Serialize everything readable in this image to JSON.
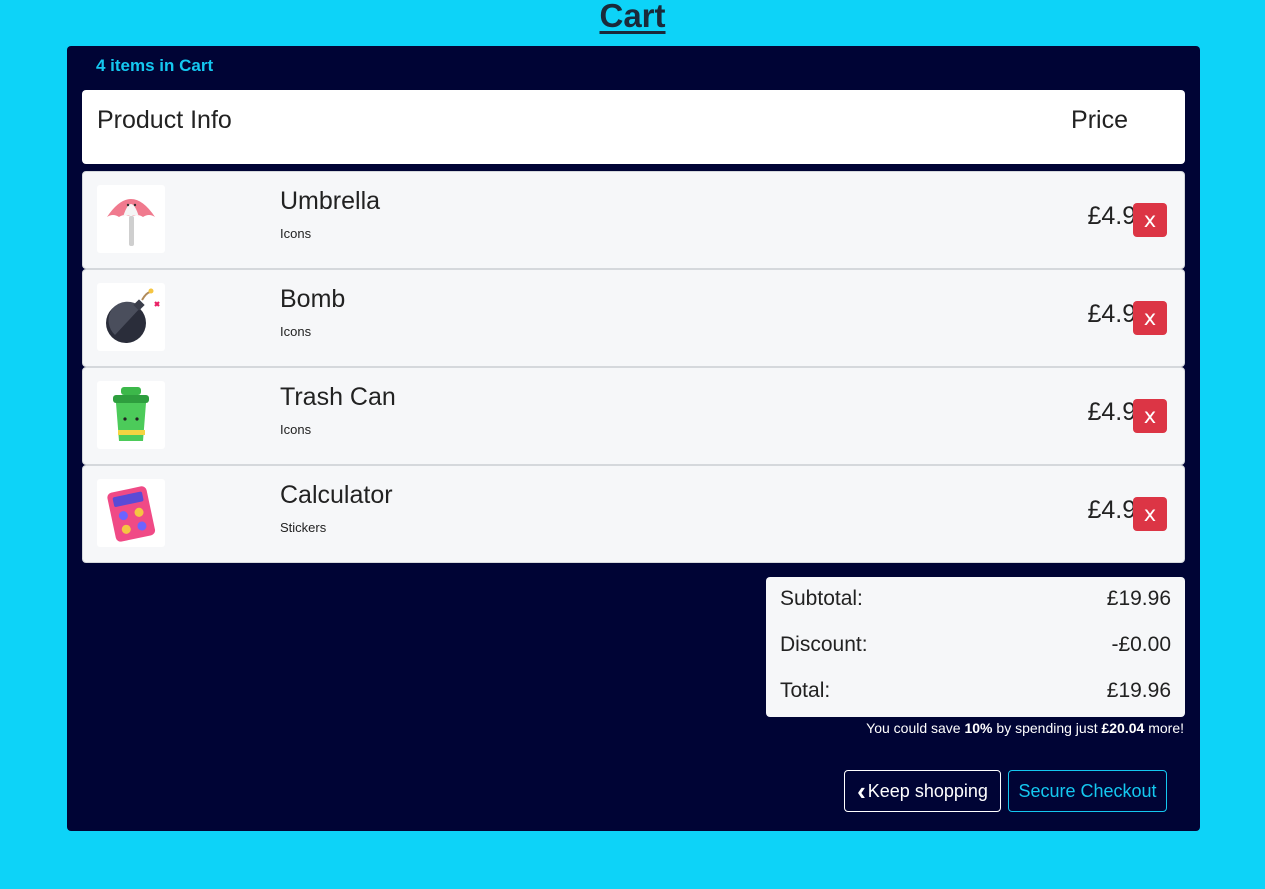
{
  "page": {
    "title": "Cart"
  },
  "cart": {
    "count_text": "4 items in Cart",
    "headers": {
      "product": "Product Info",
      "price": "Price"
    },
    "items": [
      {
        "name": "Umbrella",
        "category": "Icons",
        "price": "£4.99",
        "remove_label": "x",
        "icon": "umbrella-icon"
      },
      {
        "name": "Bomb",
        "category": "Icons",
        "price": "£4.99",
        "remove_label": "x",
        "icon": "bomb-icon"
      },
      {
        "name": "Trash Can",
        "category": "Icons",
        "price": "£4.99",
        "remove_label": "x",
        "icon": "trash-can-icon"
      },
      {
        "name": "Calculator",
        "category": "Stickers",
        "price": "£4.99",
        "remove_label": "x",
        "icon": "calculator-icon"
      }
    ]
  },
  "summary": {
    "subtotal_label": "Subtotal:",
    "subtotal": "£19.96",
    "discount_label": "Discount:",
    "discount": "-£0.00",
    "total_label": "Total:",
    "total": "£19.96"
  },
  "promo": {
    "part1": "You could save ",
    "percent": "10%",
    "part2": " by spending just ",
    "amount": "£20.04",
    "part3": " more!"
  },
  "actions": {
    "keep_chevron": "‹",
    "keep_shopping": "Keep shopping",
    "checkout": "Secure Checkout"
  },
  "colors": {
    "background": "#0dd3f8",
    "panel": "#000435",
    "accent": "#14c8f0",
    "danger": "#dc3545"
  }
}
